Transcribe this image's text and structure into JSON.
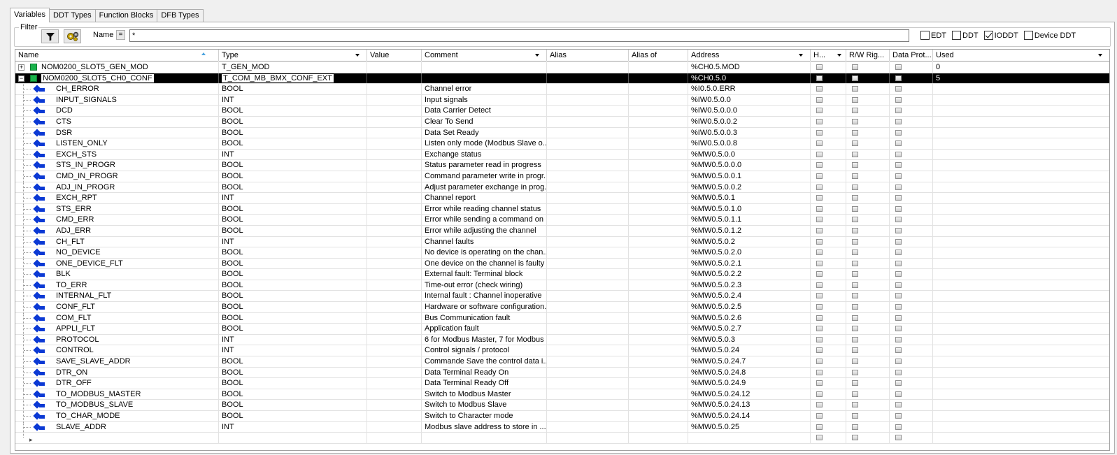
{
  "tabs": [
    "Variables",
    "DDT Types",
    "Function Blocks",
    "DFB Types"
  ],
  "filter": {
    "legend": "Filter",
    "name_label": "Name",
    "eq": "=",
    "name_value": "*",
    "checks": [
      {
        "label": "EDT",
        "checked": false
      },
      {
        "label": "DDT",
        "checked": false
      },
      {
        "label": "IODDT",
        "checked": true
      },
      {
        "label": "Device DDT",
        "checked": false
      }
    ]
  },
  "columns": [
    "Name",
    "Type",
    "Value",
    "Comment",
    "Alias",
    "Alias of",
    "Address",
    "H...",
    "R/W Rig...",
    "Data Prot...",
    "Used"
  ],
  "rows": [
    {
      "level": 0,
      "name": "NOM0200_SLOT5_GEN_MOD",
      "type": "T_GEN_MOD",
      "comment": "",
      "address": "%CH0.5.MOD",
      "used": "0",
      "expander": "+"
    },
    {
      "level": 0,
      "name": "NOM0200_SLOT5_CH0_CONF",
      "type": "T_COM_MB_BMX_CONF_EXT",
      "comment": "",
      "address": "%CH0.5.0",
      "used": "5",
      "expander": "−",
      "selected": true
    },
    {
      "level": 1,
      "name": "CH_ERROR",
      "type": "BOOL",
      "comment": "Channel error",
      "address": "%I0.5.0.ERR"
    },
    {
      "level": 1,
      "name": "INPUT_SIGNALS",
      "type": "INT",
      "comment": "Input signals",
      "address": "%IW0.5.0.0"
    },
    {
      "level": 1,
      "name": "DCD",
      "type": "BOOL",
      "comment": "Data Carrier Detect",
      "address": "%IW0.5.0.0.0"
    },
    {
      "level": 1,
      "name": "CTS",
      "type": "BOOL",
      "comment": "Clear To Send",
      "address": "%IW0.5.0.0.2"
    },
    {
      "level": 1,
      "name": "DSR",
      "type": "BOOL",
      "comment": "Data Set Ready",
      "address": "%IW0.5.0.0.3"
    },
    {
      "level": 1,
      "name": "LISTEN_ONLY",
      "type": "BOOL",
      "comment": "Listen only mode (Modbus Slave o...",
      "address": "%IW0.5.0.0.8"
    },
    {
      "level": 1,
      "name": "EXCH_STS",
      "type": "INT",
      "comment": "Exchange status",
      "address": "%MW0.5.0.0"
    },
    {
      "level": 1,
      "name": "STS_IN_PROGR",
      "type": "BOOL",
      "comment": "Status parameter read in progress",
      "address": "%MW0.5.0.0.0"
    },
    {
      "level": 1,
      "name": "CMD_IN_PROGR",
      "type": "BOOL",
      "comment": "Command parameter write in progr...",
      "address": "%MW0.5.0.0.1"
    },
    {
      "level": 1,
      "name": "ADJ_IN_PROGR",
      "type": "BOOL",
      "comment": "Adjust parameter exchange in prog...",
      "address": "%MW0.5.0.0.2"
    },
    {
      "level": 1,
      "name": "EXCH_RPT",
      "type": "INT",
      "comment": "Channel report",
      "address": "%MW0.5.0.1"
    },
    {
      "level": 1,
      "name": "STS_ERR",
      "type": "BOOL",
      "comment": "Error while reading channel status",
      "address": "%MW0.5.0.1.0"
    },
    {
      "level": 1,
      "name": "CMD_ERR",
      "type": "BOOL",
      "comment": "Error while sending a command on ...",
      "address": "%MW0.5.0.1.1"
    },
    {
      "level": 1,
      "name": "ADJ_ERR",
      "type": "BOOL",
      "comment": "Error while adjusting the channel",
      "address": "%MW0.5.0.1.2"
    },
    {
      "level": 1,
      "name": "CH_FLT",
      "type": "INT",
      "comment": "Channel faults",
      "address": "%MW0.5.0.2"
    },
    {
      "level": 1,
      "name": "NO_DEVICE",
      "type": "BOOL",
      "comment": "No device is operating on the chan...",
      "address": "%MW0.5.0.2.0"
    },
    {
      "level": 1,
      "name": "ONE_DEVICE_FLT",
      "type": "BOOL",
      "comment": "One device on the channel is faulty",
      "address": "%MW0.5.0.2.1"
    },
    {
      "level": 1,
      "name": "BLK",
      "type": "BOOL",
      "comment": "External fault: Terminal block",
      "address": "%MW0.5.0.2.2"
    },
    {
      "level": 1,
      "name": "TO_ERR",
      "type": "BOOL",
      "comment": "Time-out error (check wiring)",
      "address": "%MW0.5.0.2.3"
    },
    {
      "level": 1,
      "name": "INTERNAL_FLT",
      "type": "BOOL",
      "comment": "Internal fault : Channel inoperative",
      "address": "%MW0.5.0.2.4"
    },
    {
      "level": 1,
      "name": "CONF_FLT",
      "type": "BOOL",
      "comment": "Hardware or software configuration...",
      "address": "%MW0.5.0.2.5"
    },
    {
      "level": 1,
      "name": "COM_FLT",
      "type": "BOOL",
      "comment": "Bus Communication fault",
      "address": "%MW0.5.0.2.6"
    },
    {
      "level": 1,
      "name": "APPLI_FLT",
      "type": "BOOL",
      "comment": "Application fault",
      "address": "%MW0.5.0.2.7"
    },
    {
      "level": 1,
      "name": "PROTOCOL",
      "type": "INT",
      "comment": "6 for Modbus Master, 7 for Modbus ...",
      "address": "%MW0.5.0.3"
    },
    {
      "level": 1,
      "name": "CONTROL",
      "type": "INT",
      "comment": "Control signals / protocol",
      "address": "%MW0.5.0.24"
    },
    {
      "level": 1,
      "name": "SAVE_SLAVE_ADDR",
      "type": "BOOL",
      "comment": "Commande Save the control data i...",
      "address": "%MW0.5.0.24.7"
    },
    {
      "level": 1,
      "name": "DTR_ON",
      "type": "BOOL",
      "comment": "Data Terminal Ready On",
      "address": "%MW0.5.0.24.8"
    },
    {
      "level": 1,
      "name": "DTR_OFF",
      "type": "BOOL",
      "comment": "Data Terminal Ready Off",
      "address": "%MW0.5.0.24.9"
    },
    {
      "level": 1,
      "name": "TO_MODBUS_MASTER",
      "type": "BOOL",
      "comment": "Switch to Modbus Master",
      "address": "%MW0.5.0.24.12"
    },
    {
      "level": 1,
      "name": "TO_MODBUS_SLAVE",
      "type": "BOOL",
      "comment": "Switch to Modbus Slave",
      "address": "%MW0.5.0.24.13"
    },
    {
      "level": 1,
      "name": "TO_CHAR_MODE",
      "type": "BOOL",
      "comment": "Switch to Character mode",
      "address": "%MW0.5.0.24.14"
    },
    {
      "level": 1,
      "name": "SLAVE_ADDR",
      "type": "INT",
      "comment": "Modbus slave address to store in ...",
      "address": "%MW0.5.0.25"
    },
    {
      "level": -1,
      "name": "",
      "type": "",
      "comment": "",
      "address": ""
    }
  ]
}
